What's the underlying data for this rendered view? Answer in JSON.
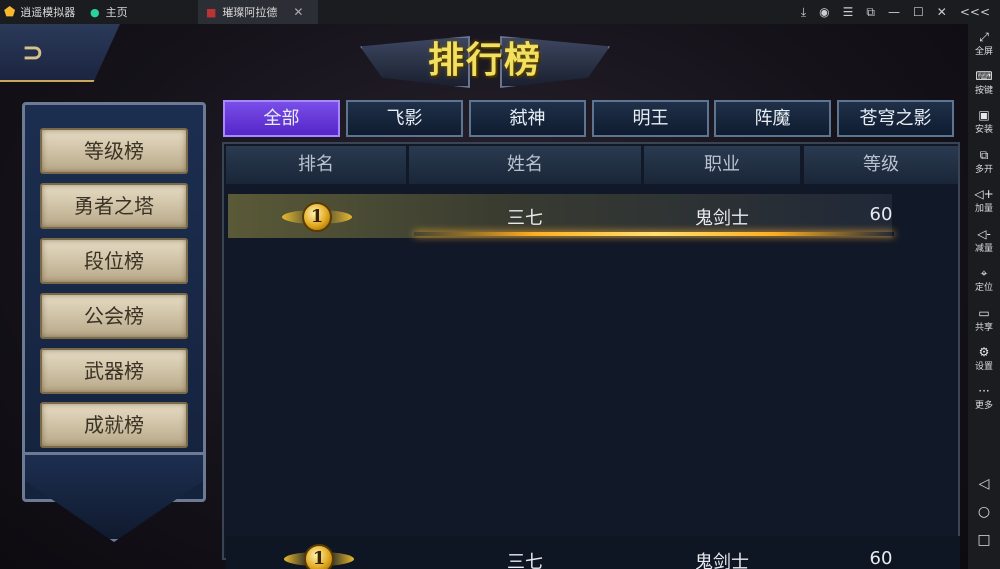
{
  "titlebar": {
    "app_name": "逍遥模拟器",
    "tab_home": "主页",
    "tab_game": "璀璨阿拉德",
    "tab_close": "✕"
  },
  "sidebar": {
    "collapse": "<<<",
    "items": [
      {
        "icon": "⤢",
        "icon_name": "fullscreen-icon",
        "label": "全屏"
      },
      {
        "icon": "⌨",
        "icon_name": "keyboard-icon",
        "label": "按键"
      },
      {
        "icon": "▣",
        "icon_name": "apk-install-icon",
        "label": "安装"
      },
      {
        "icon": "⧉",
        "icon_name": "multi-instance-icon",
        "label": "多开"
      },
      {
        "icon": "◁+",
        "icon_name": "volume-up-icon",
        "label": "加量"
      },
      {
        "icon": "◁-",
        "icon_name": "volume-down-icon",
        "label": "减量"
      },
      {
        "icon": "⌖",
        "icon_name": "location-icon",
        "label": "定位"
      },
      {
        "icon": "▭",
        "icon_name": "share-folder-icon",
        "label": "共享"
      },
      {
        "icon": "⚙",
        "icon_name": "settings-icon",
        "label": "设置"
      },
      {
        "icon": "···",
        "icon_name": "more-icon",
        "label": "更多"
      }
    ],
    "nav": {
      "back": "◁",
      "home": "○",
      "recent": "□"
    }
  },
  "game": {
    "banner_title": "排行榜",
    "tabs": [
      "全部",
      "飞影",
      "弑神",
      "明王",
      "阵魔",
      "苍穹之影"
    ],
    "active_tab": 0,
    "left_menu": [
      "等级榜",
      "勇者之塔",
      "段位榜",
      "公会榜",
      "武器榜",
      "成就榜"
    ],
    "table": {
      "headers": [
        "排名",
        "姓名",
        "职业",
        "等级"
      ],
      "rows": [
        {
          "rank": "1",
          "name": "三七",
          "job": "鬼剑士",
          "level": "60"
        }
      ],
      "my_rank": {
        "rank": "1",
        "name": "三七",
        "job": "鬼剑士",
        "level": "60"
      }
    }
  },
  "colors": {
    "accent": "#6a3ee0",
    "gold": "#f2e060"
  }
}
